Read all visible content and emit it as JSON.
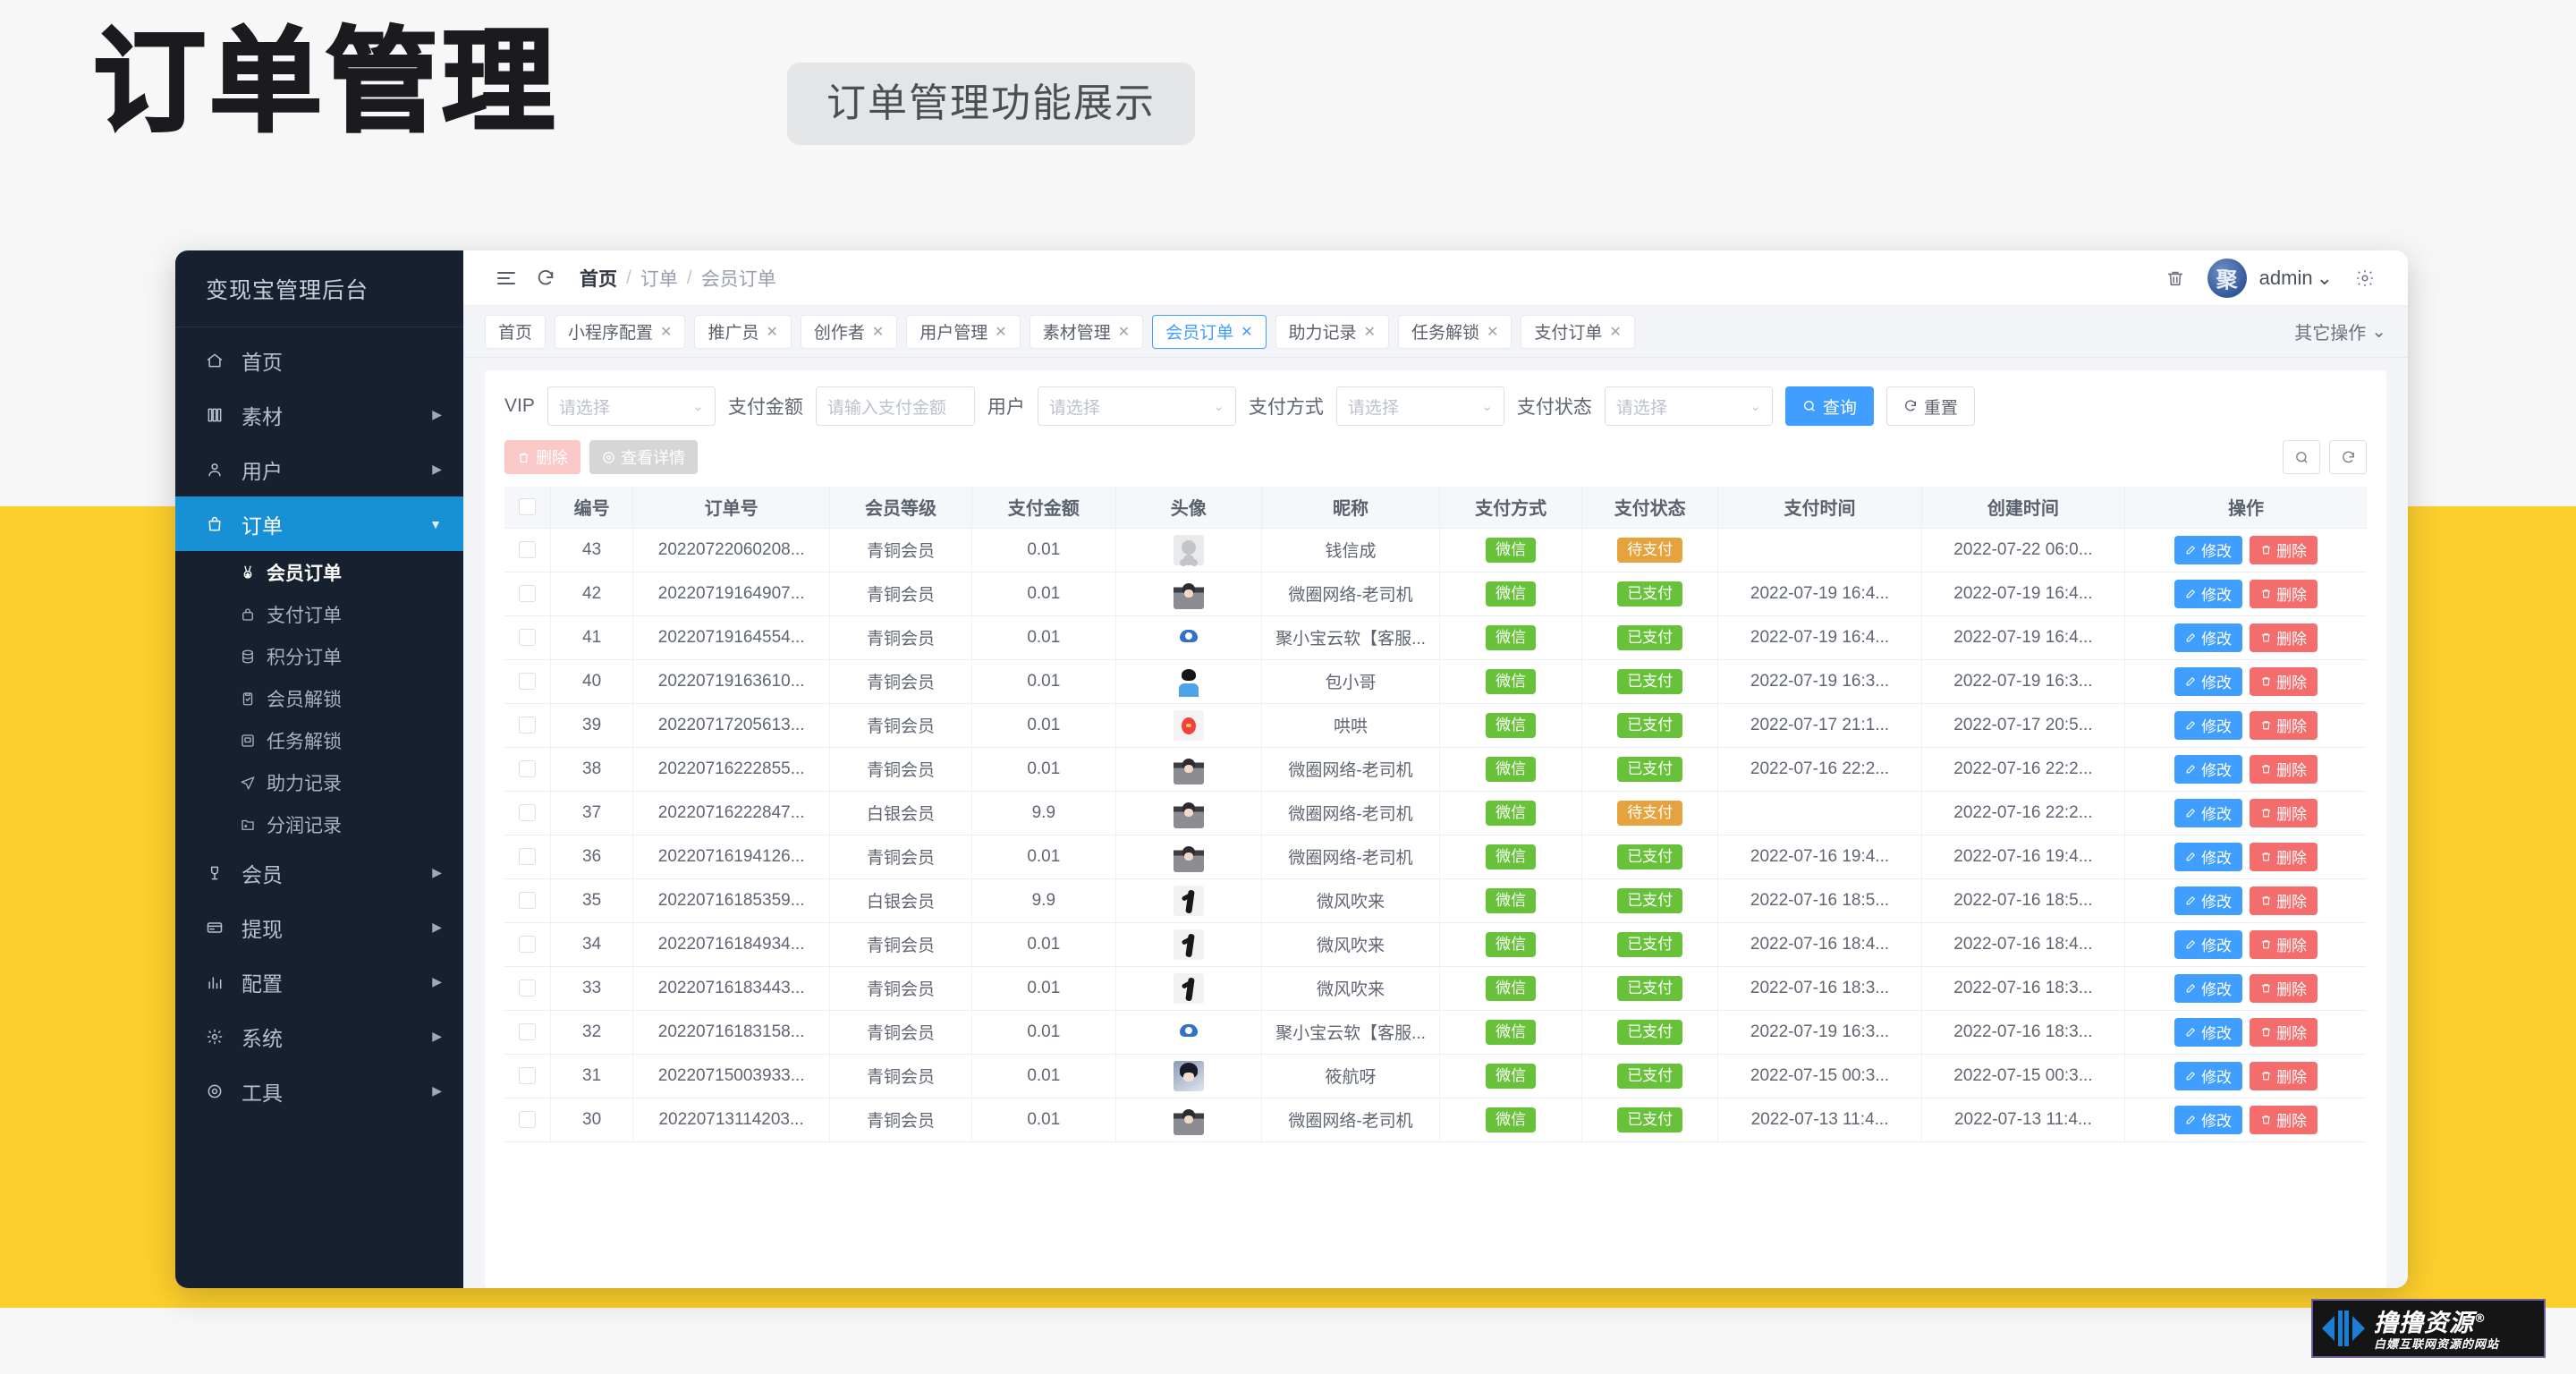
{
  "poster": {
    "title": "订单管理",
    "subtitle": "订单管理功能展示"
  },
  "sidebar": {
    "brand": "变现宝管理后台",
    "items": [
      {
        "label": "首页",
        "icon": "home-icon",
        "arrow": ""
      },
      {
        "label": "素材",
        "icon": "book-icon",
        "arrow": "▶"
      },
      {
        "label": "用户",
        "icon": "user-icon",
        "arrow": "▶"
      },
      {
        "label": "订单",
        "icon": "bag-icon",
        "arrow": "▼",
        "active": true
      }
    ],
    "sub_items": [
      {
        "label": "会员订单",
        "icon": "medal-icon",
        "current": true
      },
      {
        "label": "支付订单",
        "icon": "lock-bag-icon"
      },
      {
        "label": "积分订单",
        "icon": "database-icon"
      },
      {
        "label": "会员解锁",
        "icon": "clipboard-check-icon"
      },
      {
        "label": "任务解锁",
        "icon": "task-icon"
      },
      {
        "label": "助力记录",
        "icon": "send-icon"
      },
      {
        "label": "分润记录",
        "icon": "folder-icon"
      }
    ],
    "items_bottom": [
      {
        "label": "会员",
        "icon": "vip-icon",
        "arrow": "▶"
      },
      {
        "label": "提现",
        "icon": "card-icon",
        "arrow": "▶"
      },
      {
        "label": "配置",
        "icon": "chart-icon",
        "arrow": "▶"
      },
      {
        "label": "系统",
        "icon": "gear-icon",
        "arrow": "▶"
      },
      {
        "label": "工具",
        "icon": "tool-icon",
        "arrow": "▶"
      }
    ]
  },
  "topbar": {
    "menu_icon": "hamburger-icon",
    "refresh_icon": "refresh-icon",
    "breadcrumb": [
      "首页",
      "订单",
      "会员订单"
    ],
    "trash_icon": "trash-icon",
    "avatar_text": "聚",
    "admin_label": "admin",
    "settings_icon": "gear-icon"
  },
  "tabs": [
    {
      "label": "首页",
      "closable": false
    },
    {
      "label": "小程序配置",
      "closable": true
    },
    {
      "label": "推广员",
      "closable": true
    },
    {
      "label": "创作者",
      "closable": true
    },
    {
      "label": "用户管理",
      "closable": true
    },
    {
      "label": "素材管理",
      "closable": true
    },
    {
      "label": "会员订单",
      "closable": true,
      "active": true
    },
    {
      "label": "助力记录",
      "closable": true
    },
    {
      "label": "任务解锁",
      "closable": true
    },
    {
      "label": "支付订单",
      "closable": true
    }
  ],
  "tab_more": "其它操作",
  "filters": [
    {
      "label": "VIP",
      "type": "select",
      "placeholder": "请选择"
    },
    {
      "label": "支付金额",
      "type": "input",
      "placeholder": "请输入支付金额"
    },
    {
      "label": "用户",
      "type": "select",
      "placeholder": "请选择",
      "wide": true
    },
    {
      "label": "支付方式",
      "type": "select",
      "placeholder": "请选择"
    },
    {
      "label": "支付状态",
      "type": "select",
      "placeholder": "请选择"
    }
  ],
  "filter_buttons": {
    "search": "查询",
    "reset": "重置"
  },
  "action_buttons": {
    "delete": "删除",
    "detail": "查看详情"
  },
  "table": {
    "columns": [
      "",
      "编号",
      "订单号",
      "会员等级",
      "支付金额",
      "头像",
      "昵称",
      "支付方式",
      "支付状态",
      "支付时间",
      "创建时间",
      "操作"
    ],
    "row_buttons": {
      "edit": "修改",
      "delete": "删除"
    },
    "rows": [
      {
        "id": "43",
        "order_no": "20220722060208...",
        "level": "青铜会员",
        "amount": "0.01",
        "avatar": "av-gray",
        "nickname": "钱信成",
        "pay_method": "微信",
        "status": "待支付",
        "pay_time": "",
        "create_time": "2022-07-22 06:0..."
      },
      {
        "id": "42",
        "order_no": "20220719164907...",
        "level": "青铜会员",
        "amount": "0.01",
        "avatar": "av-man",
        "nickname": "微圈网络-老司机",
        "pay_method": "微信",
        "status": "已支付",
        "pay_time": "2022-07-19 16:4...",
        "create_time": "2022-07-19 16:4..."
      },
      {
        "id": "41",
        "order_no": "20220719164554...",
        "level": "青铜会员",
        "amount": "0.01",
        "avatar": "av-cloud",
        "nickname": "聚小宝云软【客服...",
        "pay_method": "微信",
        "status": "已支付",
        "pay_time": "2022-07-19 16:4...",
        "create_time": "2022-07-19 16:4..."
      },
      {
        "id": "40",
        "order_no": "20220719163610...",
        "level": "青铜会员",
        "amount": "0.01",
        "avatar": "av-blue",
        "nickname": "包小哥",
        "pay_method": "微信",
        "status": "已支付",
        "pay_time": "2022-07-19 16:3...",
        "create_time": "2022-07-19 16:3..."
      },
      {
        "id": "39",
        "order_no": "20220717205613...",
        "level": "青铜会员",
        "amount": "0.01",
        "avatar": "av-red",
        "nickname": "哄哄",
        "pay_method": "微信",
        "status": "已支付",
        "pay_time": "2022-07-17 21:1...",
        "create_time": "2022-07-17 20:5..."
      },
      {
        "id": "38",
        "order_no": "20220716222855...",
        "level": "青铜会员",
        "amount": "0.01",
        "avatar": "av-man",
        "nickname": "微圈网络-老司机",
        "pay_method": "微信",
        "status": "已支付",
        "pay_time": "2022-07-16 22:2...",
        "create_time": "2022-07-16 22:2..."
      },
      {
        "id": "37",
        "order_no": "20220716222847...",
        "level": "白银会员",
        "amount": "9.9",
        "avatar": "av-man",
        "nickname": "微圈网络-老司机",
        "pay_method": "微信",
        "status": "待支付",
        "pay_time": "",
        "create_time": "2022-07-16 22:2..."
      },
      {
        "id": "36",
        "order_no": "20220716194126...",
        "level": "青铜会员",
        "amount": "0.01",
        "avatar": "av-man",
        "nickname": "微圈网络-老司机",
        "pay_method": "微信",
        "status": "已支付",
        "pay_time": "2022-07-16 19:4...",
        "create_time": "2022-07-16 19:4..."
      },
      {
        "id": "35",
        "order_no": "20220716185359...",
        "level": "白银会员",
        "amount": "9.9",
        "avatar": "av-dancer",
        "nickname": "微风吹来",
        "pay_method": "微信",
        "status": "已支付",
        "pay_time": "2022-07-16 18:5...",
        "create_time": "2022-07-16 18:5..."
      },
      {
        "id": "34",
        "order_no": "20220716184934...",
        "level": "青铜会员",
        "amount": "0.01",
        "avatar": "av-dancer",
        "nickname": "微风吹来",
        "pay_method": "微信",
        "status": "已支付",
        "pay_time": "2022-07-16 18:4...",
        "create_time": "2022-07-16 18:4..."
      },
      {
        "id": "33",
        "order_no": "20220716183443...",
        "level": "青铜会员",
        "amount": "0.01",
        "avatar": "av-dancer",
        "nickname": "微风吹来",
        "pay_method": "微信",
        "status": "已支付",
        "pay_time": "2022-07-16 18:3...",
        "create_time": "2022-07-16 18:3..."
      },
      {
        "id": "32",
        "order_no": "20220716183158...",
        "level": "青铜会员",
        "amount": "0.01",
        "avatar": "av-cloud",
        "nickname": "聚小宝云软【客服...",
        "pay_method": "微信",
        "status": "已支付",
        "pay_time": "2022-07-19 16:3...",
        "create_time": "2022-07-16 18:3..."
      },
      {
        "id": "31",
        "order_no": "20220715003933...",
        "level": "青铜会员",
        "amount": "0.01",
        "avatar": "av-anime",
        "nickname": "筱航呀",
        "pay_method": "微信",
        "status": "已支付",
        "pay_time": "2022-07-15 00:3...",
        "create_time": "2022-07-15 00:3..."
      },
      {
        "id": "30",
        "order_no": "20220713114203...",
        "level": "青铜会员",
        "amount": "0.01",
        "avatar": "av-man",
        "nickname": "微圈网络-老司机",
        "pay_method": "微信",
        "status": "已支付",
        "pay_time": "2022-07-13 11:4...",
        "create_time": "2022-07-13 11:4..."
      }
    ]
  },
  "watermark": {
    "main": "撸撸资源",
    "reg": "®",
    "sub": "白嫖互联网资源的网站"
  },
  "colors": {
    "accent": "#409eff",
    "sidebar_bg": "#16202f",
    "sidebar_active": "#1890d6",
    "success": "#67c23a",
    "warning": "#e6a23c",
    "danger": "#f56c6c",
    "poster_band": "#fdcf2c"
  }
}
